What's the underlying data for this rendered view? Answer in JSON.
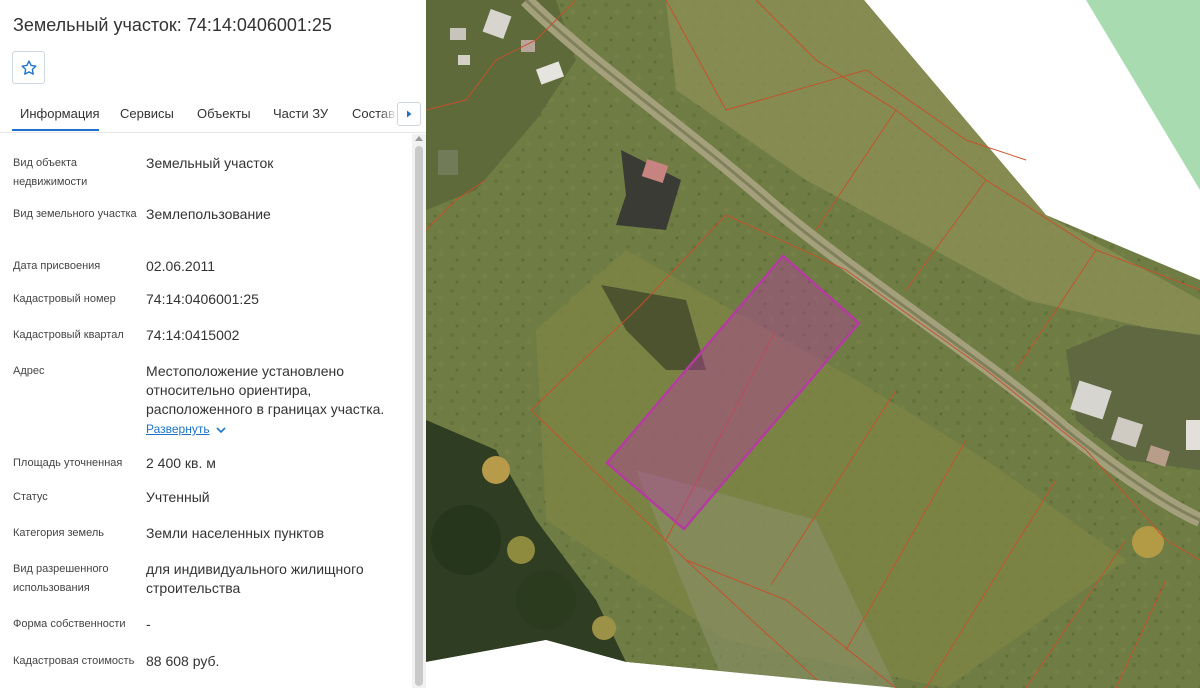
{
  "panel": {
    "title": "Земельный участок: 74:14:0406001:25",
    "favorite_icon": "star-outline-icon",
    "tabs": [
      {
        "label": "Информация",
        "active": true
      },
      {
        "label": "Сервисы"
      },
      {
        "label": "Объекты"
      },
      {
        "label": "Части ЗУ"
      },
      {
        "label": "Состав"
      }
    ],
    "tabs_next_icon": "caret-right-icon",
    "fields": [
      {
        "label": "Вид объекта недвижимости",
        "value": "Земельный участок"
      },
      {
        "label": "Вид земельного участка",
        "value": "Землепользование"
      },
      {
        "label": "Дата присвоения",
        "value": "02.06.2011"
      },
      {
        "label": "Кадастровый номер",
        "value": "74:14:0406001:25"
      },
      {
        "label": "Кадастровый квартал",
        "value": "74:14:0415002"
      },
      {
        "label": "Адрес",
        "value": "Местоположение установлено относительно ориентира, расположенного в границах участка.",
        "expand_label": "Развернуть"
      },
      {
        "label": "Площадь уточненная",
        "value": "2 400 кв. м"
      },
      {
        "label": "Статус",
        "value": "Учтенный"
      },
      {
        "label": "Категория земель",
        "value": "Земли населенных пунктов"
      },
      {
        "label": "Вид разрешенного использования",
        "value": "для индивидуального жилищного строительства"
      },
      {
        "label": "Форма собственности",
        "value": "-"
      },
      {
        "label": "Кадастровая стоимость",
        "value": "88 608 руб."
      }
    ]
  },
  "map": {
    "selected_parcel_color": "#b43ca0",
    "parcel_border_color": "#c8502a",
    "zone_color": "#a8dcb0"
  }
}
